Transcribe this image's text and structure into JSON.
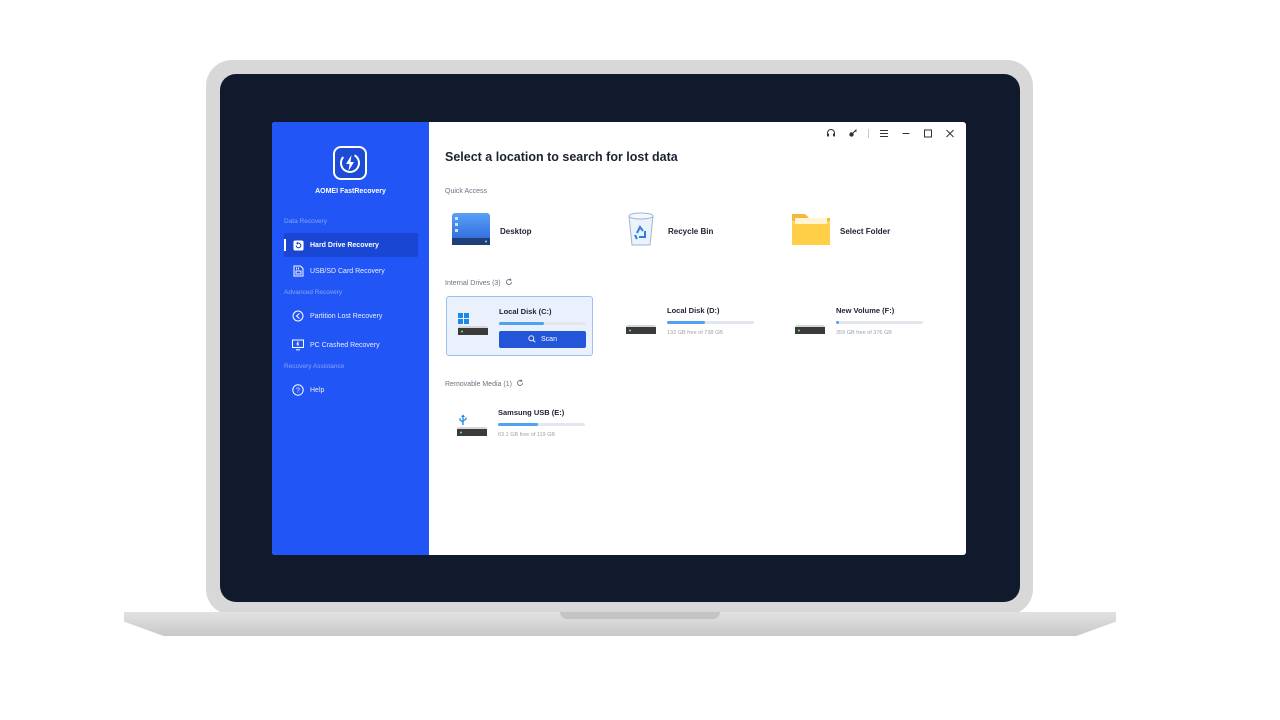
{
  "app": {
    "name": "AOMEI FastRecovery"
  },
  "colors": {
    "sidebar": "#2255f5",
    "accent": "#2255d8",
    "bezel": "#111a2c",
    "bar_fill": "#4fa2f0"
  },
  "sidebar": {
    "sections": [
      {
        "label": "Data Recovery",
        "items": [
          {
            "label": "Hard Drive Recovery",
            "icon": "restore-icon",
            "active": true
          },
          {
            "label": "USB/SD Card Recovery",
            "icon": "sd-card-icon"
          }
        ]
      },
      {
        "label": "Advanced Recovery",
        "items": [
          {
            "label": "Partition Lost Recovery",
            "icon": "partition-icon"
          },
          {
            "label": "PC Crashed Recovery",
            "icon": "monitor-icon"
          }
        ]
      },
      {
        "label": "Recovery Assistance",
        "items": [
          {
            "label": "Help",
            "icon": "help-icon"
          }
        ]
      }
    ]
  },
  "titlebar": {
    "icons": [
      "headset-icon",
      "key-icon",
      "menu-icon",
      "minimize-icon",
      "maximize-icon",
      "close-icon"
    ]
  },
  "main": {
    "title": "Select a location to search for lost data",
    "quick_access": {
      "label": "Quick Access",
      "items": [
        {
          "label": "Desktop",
          "icon": "desktop-icon"
        },
        {
          "label": "Recycle Bin",
          "icon": "recycle-bin-icon"
        },
        {
          "label": "Select Folder",
          "icon": "folder-icon"
        }
      ]
    },
    "internal_drives": {
      "label": "Internal Drives (3)",
      "drives": [
        {
          "name": "Local Disk (C:)",
          "used_fraction": 0.52,
          "free": "",
          "selected": true,
          "scan_label": "Scan"
        },
        {
          "name": "Local Disk (D:)",
          "used_fraction": 0.44,
          "free": "132 GB free of 738 GB"
        },
        {
          "name": "New Volume (F:)",
          "used_fraction": 0.03,
          "free": "359 GB free of 376 GB"
        }
      ]
    },
    "removable_media": {
      "label": "Removable Media (1)",
      "drives": [
        {
          "name": "Samsung USB (E:)",
          "used_fraction": 0.46,
          "free": "63.1 GB free of 119 GB"
        }
      ]
    }
  }
}
